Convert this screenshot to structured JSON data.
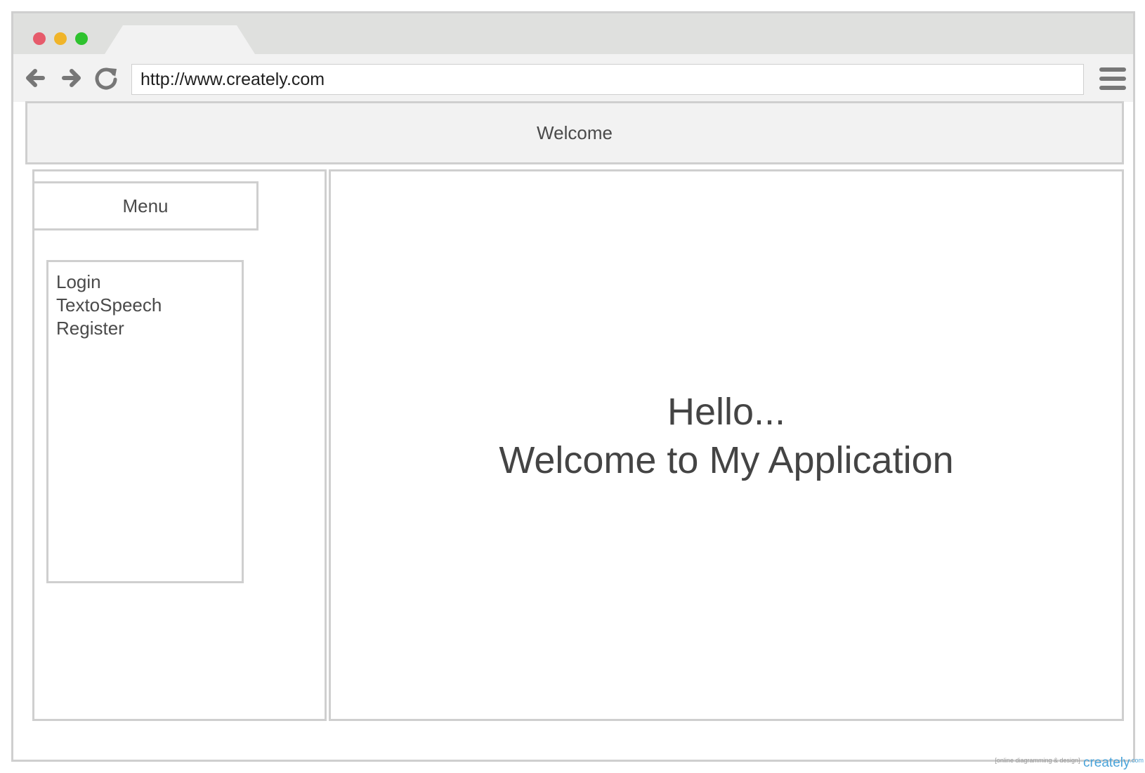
{
  "window": {
    "controls": {
      "close_color": "#e65b6b",
      "minimize_color": "#f0b429",
      "maximize_color": "#2ec22e"
    },
    "tab_color": "#f2f2f2"
  },
  "toolbar": {
    "back_icon": "arrow-left-icon",
    "forward_icon": "arrow-right-icon",
    "reload_icon": "reload-icon",
    "url": "http://www.creately.com",
    "menu_icon": "hamburger-menu-icon"
  },
  "header": {
    "title": "Welcome"
  },
  "sidebar": {
    "menu_title": "Menu",
    "items": [
      {
        "label": "Login"
      },
      {
        "label": "TextoSpeech"
      },
      {
        "label": "Register"
      }
    ]
  },
  "main": {
    "greeting": "Hello...",
    "headline": "Welcome to My Application"
  },
  "watermark": {
    "tagline": "[online diagramming & design]",
    "brand": "creately",
    "suffix": ".com",
    "brand_color": "#4aa3d9"
  }
}
